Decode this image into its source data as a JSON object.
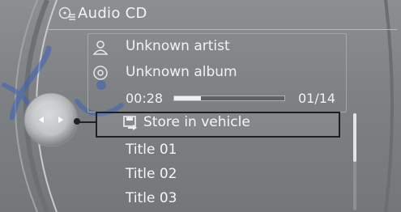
{
  "header": {
    "title": "Audio CD",
    "icon": "cd-eject-icon"
  },
  "info": {
    "artist": "Unknown artist",
    "album": "Unknown album",
    "elapsed_time": "00:28",
    "track_counter": "01/14",
    "progress_fraction": 0.24,
    "artist_icon": "person-icon",
    "album_icon": "disc-icon"
  },
  "list": {
    "selected": {
      "label": "Store in vehicle",
      "icon": "save-to-vehicle-icon"
    },
    "items": [
      {
        "label": "Title  01"
      },
      {
        "label": "Title  02"
      },
      {
        "label": "Title  03"
      }
    ]
  },
  "scrollbar": {
    "position_fraction": 0.0,
    "visible_fraction": 0.5
  },
  "colors": {
    "text": "#f5f5f5",
    "background": "#7e8184",
    "selection_border": "#1e1f20"
  }
}
